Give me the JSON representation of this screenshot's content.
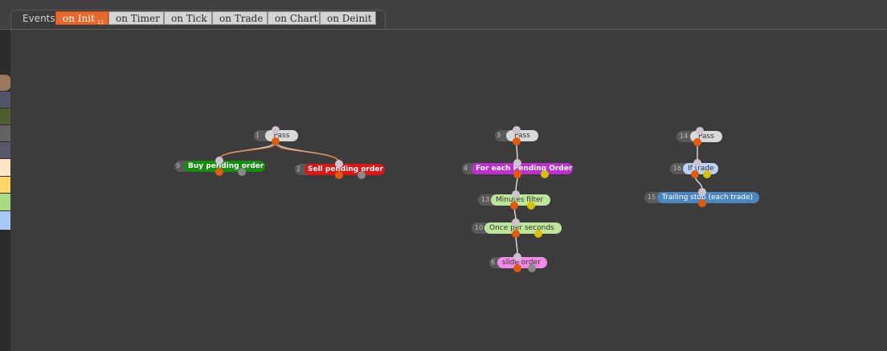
{
  "tabs": {
    "events_label": "Events",
    "items": [
      {
        "label": "on Init",
        "badge": "11",
        "active": true
      },
      {
        "label": "on Timer"
      },
      {
        "label": "on Tick"
      },
      {
        "label": "on Trade"
      },
      {
        "label": "on Chart"
      },
      {
        "label": "on Deinit"
      }
    ]
  },
  "palette": {
    "swatches": [
      "#9a7a5a",
      "#545469",
      "#4e5e30",
      "#636363",
      "#585868",
      "#fde4c2",
      "#fdd56a",
      "#a9dc80",
      "#a7c7f5"
    ]
  },
  "nodes": [
    {
      "id": "1",
      "label": "Pass",
      "color": "#d9d9d9",
      "text_color": "#333333",
      "bold": false
    },
    {
      "id": "9",
      "label": "Buy pending order",
      "color": "#138e0e",
      "text_color": "#ffffff",
      "bold": true
    },
    {
      "id": "2",
      "label": "Sell pending order",
      "color": "#e01414",
      "text_color": "#ffffff",
      "bold": true
    },
    {
      "id": "3",
      "label": "Pass",
      "color": "#d9d9d9",
      "text_color": "#333333",
      "bold": false
    },
    {
      "id": "4",
      "label": "For each Pending Order",
      "color": "#c12ed0",
      "text_color": "#ffffff",
      "bold": true
    },
    {
      "id": "13",
      "label": "Minutes filter",
      "color": "#bee69a",
      "text_color": "#333333",
      "bold": false
    },
    {
      "id": "10",
      "label": "Once per seconds",
      "color": "#bee69a",
      "text_color": "#333333",
      "bold": false
    },
    {
      "id": "6",
      "label": "slide order",
      "color": "#f28ae6",
      "text_color": "#333333",
      "bold": false
    },
    {
      "id": "14",
      "label": "Pass",
      "color": "#d9d9d9",
      "text_color": "#333333",
      "bold": false
    },
    {
      "id": "16",
      "label": "If trade",
      "color": "#bcd2f6",
      "text_color": "#333333",
      "bold": false
    },
    {
      "id": "15",
      "label": "Trailing stop (each trade)",
      "color": "#4a86c0",
      "text_color": "#ffffff",
      "bold": false
    }
  ],
  "edges": [
    {
      "from": "1",
      "to": "9"
    },
    {
      "from": "1",
      "to": "2"
    },
    {
      "from": "3",
      "to": "4"
    },
    {
      "from": "4",
      "to": "13"
    },
    {
      "from": "13",
      "to": "10"
    },
    {
      "from": "10",
      "to": "6"
    },
    {
      "from": "14",
      "to": "16"
    },
    {
      "from": "16",
      "to": "15"
    }
  ]
}
